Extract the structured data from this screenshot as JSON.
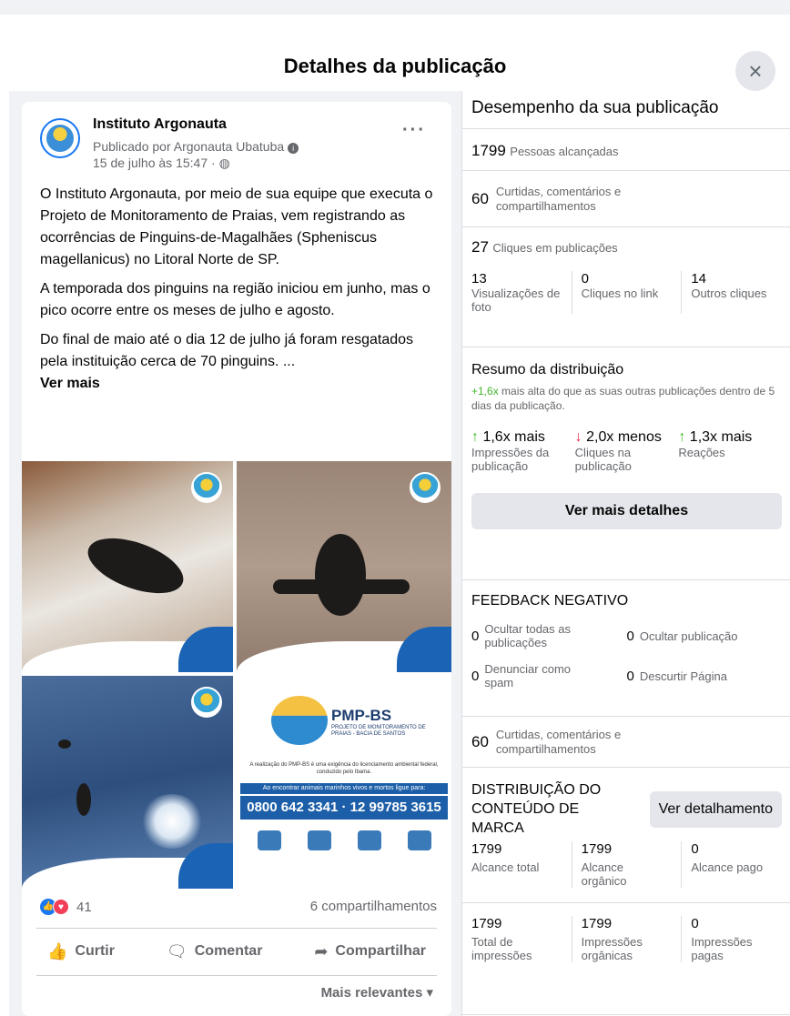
{
  "dialog": {
    "title": "Detalhes da publicação",
    "close_symbol": "×"
  },
  "post": {
    "page_name": "Instituto Argonauta",
    "published_by": "Publicado por Argonauta Ubatuba",
    "date": "15 de julho às 15:47",
    "paragraphs": [
      "O Instituto Argonauta, por meio de sua equipe que executa o Projeto de Monitoramento de Praias, vem registrando as ocorrências de Pinguins-de-Magalhães (Spheniscus magellanicus) no Litoral Norte de SP.",
      "A temporada dos pinguins na região iniciou em junho, mas o pico ocorre entre os meses de julho e agosto.",
      "Do final de maio até o dia 12 de julho já foram resgatados pela instituição cerca de 70 pinguins. ..."
    ],
    "see_more": "Ver mais",
    "flyer": {
      "title": "PMP-BS",
      "subtitle": "PROJETO DE MONITORAMENTO DE PRAIAS - BACIA DE SANTOS",
      "note": "A realização do PMP-BS é uma exigência do licenciamento ambiental federal, conduzido pelo Ibama.",
      "bar_text": "Ao encontrar animais marinhos vivos e mortos ligue para:",
      "phone": "0800 642 3341 · 12 99785 3615"
    },
    "reactions_count": "41",
    "shares": "6 compartilhamentos",
    "actions": {
      "like": "Curtir",
      "comment": "Comentar",
      "share": "Compartilhar"
    },
    "sort": "Mais relevantes"
  },
  "performance": {
    "title": "Desempenho da sua publicação",
    "reach_num": "1799",
    "reach_label": "Pessoas alcançadas",
    "engagement_num": "60",
    "engagement_label": "Curtidas, comentários e compartilhamentos",
    "clicks_num": "27",
    "clicks_label": "Cliques em publicações",
    "click_breakdown": [
      {
        "num": "13",
        "label": "Visualizações de foto"
      },
      {
        "num": "0",
        "label": "Cliques no link"
      },
      {
        "num": "14",
        "label": "Outros cliques"
      }
    ]
  },
  "distribution": {
    "title": "Resumo da distribuição",
    "delta": "+1,6x",
    "desc": "mais alta do que as suas outras publicações dentro de 5 dias da publicação.",
    "metrics": [
      {
        "arrow": "↑",
        "value": "1,6x mais",
        "label": "Impressões da publicação",
        "dir": "up"
      },
      {
        "arrow": "↓",
        "value": "2,0x menos",
        "label": "Cliques na publicação",
        "dir": "down"
      },
      {
        "arrow": "↑",
        "value": "1,3x mais",
        "label": "Reações",
        "dir": "up"
      }
    ],
    "button": "Ver mais detalhes"
  },
  "negative": {
    "title": "FEEDBACK NEGATIVO",
    "items": [
      {
        "num": "0",
        "label": "Ocultar todas as publicações"
      },
      {
        "num": "0",
        "label": "Ocultar publicação"
      },
      {
        "num": "0",
        "label": "Denunciar como spam"
      },
      {
        "num": "0",
        "label": "Descurtir Página"
      }
    ]
  },
  "engagement2": {
    "num": "60",
    "label": "Curtidas, comentários e compartilhamentos"
  },
  "branded": {
    "title": "DISTRIBUIÇÃO DO CONTEÚDO DE MARCA",
    "button": "Ver detalhamento",
    "reach": [
      {
        "num": "1799",
        "label": "Alcance total"
      },
      {
        "num": "1799",
        "label": "Alcance orgânico"
      },
      {
        "num": "0",
        "label": "Alcance pago"
      }
    ],
    "impressions": [
      {
        "num": "1799",
        "label": "Total de impressões"
      },
      {
        "num": "1799",
        "label": "Impressões orgânicas"
      },
      {
        "num": "0",
        "label": "Impressões pagas"
      }
    ]
  }
}
